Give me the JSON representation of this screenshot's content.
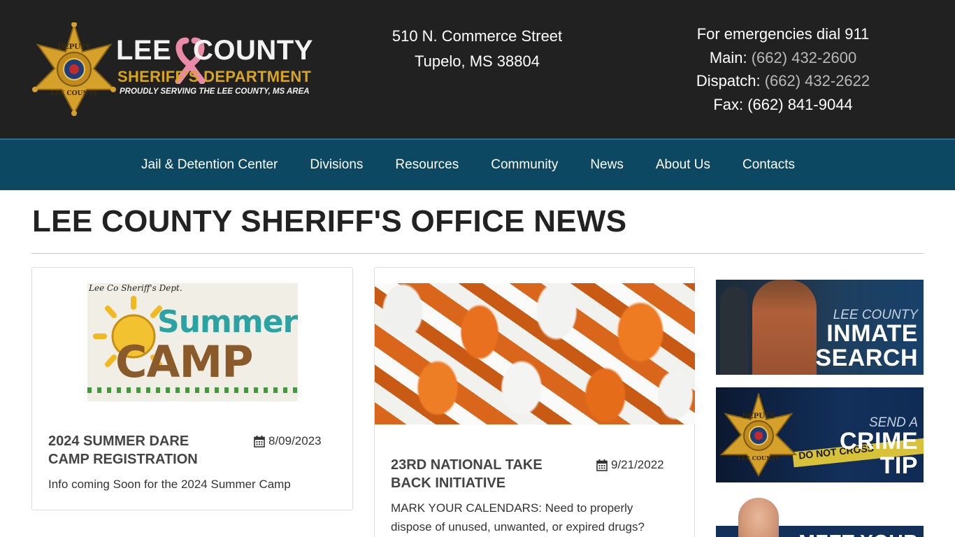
{
  "header": {
    "logo": {
      "line1a": "LEE",
      "line1b": "COUNTY",
      "line2": "SHERIFF'S DEPARTMENT",
      "line3": "PROUDLY SERVING THE LEE COUNTY, MS AREA",
      "badge_top": "DEPUTY",
      "badge_bottom": "LEE COUNTY"
    },
    "address": {
      "line1": "510 N. Commerce Street",
      "line2": "Tupelo, MS 38804"
    },
    "contact": {
      "emergency": "For emergencies dial 911",
      "main_label": "Main:",
      "main_phone": "(662) 432-2600",
      "dispatch_label": "Dispatch:",
      "dispatch_phone": "(662) 432-2622",
      "fax": "Fax: (662) 841-9044"
    }
  },
  "nav": {
    "items": [
      "Jail & Detention Center",
      "Divisions",
      "Resources",
      "Community",
      "News",
      "About Us",
      "Contacts"
    ]
  },
  "page": {
    "title": "LEE COUNTY SHERIFF'S OFFICE NEWS"
  },
  "posts": [
    {
      "image_caption": "Lee Co Sheriff's Dept.",
      "image_word1": "Summer",
      "image_word2": "CAMP",
      "title": "2024 SUMMER DARE CAMP REGISTRATION",
      "date": "8/09/2023",
      "excerpt": "Info coming Soon for the 2024 Summer Camp"
    },
    {
      "title": "23RD NATIONAL TAKE BACK INITIATIVE",
      "date": "9/21/2022",
      "excerpt": "MARK YOUR CALENDARS: Need to properly dispose of unused, unwanted, or expired drugs?"
    }
  ],
  "sidebar": {
    "inmate": {
      "small": "LEE COUNTY",
      "big1": "INMATE",
      "big2": "SEARCH"
    },
    "crime": {
      "small": "SEND A",
      "big1": "CRIME",
      "big2": "TIP",
      "tape": "DO NOT CROSS"
    },
    "meet": {
      "big": "MEET YOUR"
    }
  },
  "colors": {
    "header_bg": "#222121",
    "nav_bg": "#0d4862",
    "gold": "#d9a520",
    "ribbon": "#e88aa8"
  }
}
